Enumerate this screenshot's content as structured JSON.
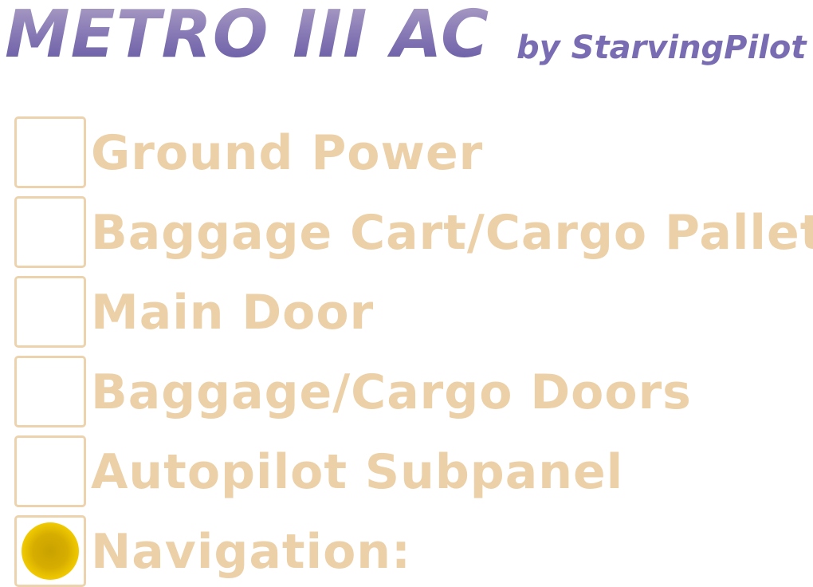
{
  "header": {
    "title": "METRO III AC",
    "byline": "by StarvingPilot"
  },
  "options": [
    {
      "label": "Ground Power",
      "checked": false
    },
    {
      "label": "Baggage Cart/Cargo Pallet",
      "checked": false
    },
    {
      "label": "Main Door",
      "checked": false
    },
    {
      "label": "Baggage/Cargo Doors",
      "checked": false
    },
    {
      "label": "Autopilot Subpanel",
      "checked": false
    },
    {
      "label": "Navigation:",
      "checked": true
    }
  ],
  "colors": {
    "title_gradient_top": "#b2a6c8",
    "title_gradient_bottom": "#5f52a0",
    "byline": "#7a6cb3",
    "label": "#ecd0a8",
    "checkbox_border": "#ecd3ae",
    "selected_indicator": "#d6ad00"
  },
  "icons": {
    "selected_indicator": "yellow-dot-icon"
  }
}
